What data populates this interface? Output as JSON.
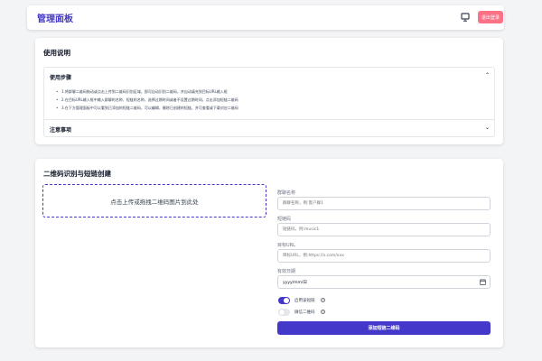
{
  "header": {
    "title": "管理面板",
    "logout_label": "退出登录",
    "monitor_icon": "monitor-icon"
  },
  "instructions": {
    "title": "使用说明",
    "steps_section": {
      "label": "使用步骤",
      "expanded": true,
      "items": [
        "1.将群聊二维码拖动或点击上传到二维码识别区域，即可自动识别二维码，并自动填充到目标URL输入框",
        "2.在目标URL输入框中输入群聊的名称、短链的名称，选择过期时间或者不设置过期时间，点击添加短链二维码",
        "3.在下方管理面板中可以看到已添加的短链二维码，可以编辑、删除已创建的短链，并可查看或下载对应二维码"
      ]
    },
    "notes_section": {
      "label": "注意事项",
      "expanded": false
    }
  },
  "create": {
    "title": "二维码识别与短链创建",
    "upload_prompt": "点击上传或拖拽二维码图片到此处",
    "fields": {
      "group_name": {
        "label": "群聊名称",
        "placeholder": "群聊名称，例:客户群1"
      },
      "short_code": {
        "label": "短链码",
        "placeholder": "短链码，例:music1"
      },
      "target_url": {
        "label": "目标URL",
        "placeholder": "目标URL，例:https://x.com/xxx"
      },
      "expire_date": {
        "label": "有效日期",
        "value": "yyyy/mm/日"
      }
    },
    "toggles": {
      "enable_short_link": {
        "label": "启用该短链",
        "on": true
      },
      "wechat_qrcode": {
        "label": "微信二维码",
        "on": false
      }
    },
    "submit_label": "添加短链二维码"
  },
  "colors": {
    "accent": "#4338ca",
    "logout": "#fb7185",
    "background": "#f3f4f6"
  }
}
